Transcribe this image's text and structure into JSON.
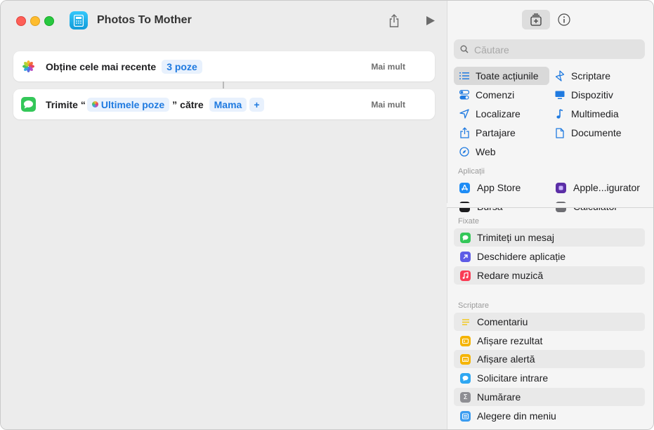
{
  "window": {
    "title": "Photos To Mother"
  },
  "actions": [
    {
      "verb": "Obține cele mai recente",
      "count": "3 poze",
      "more": "Mai mult"
    },
    {
      "verb": "Trimite",
      "quote_open": "“",
      "variable": "Ultimele poze",
      "quote_close": "”",
      "to": "către",
      "recipient": "Mama",
      "add": "+",
      "more": "Mai mult"
    }
  ],
  "search": {
    "placeholder": "Căutare"
  },
  "categories": [
    {
      "label": "Toate acțiunile",
      "icon": "list-icon"
    },
    {
      "label": "Scriptare",
      "icon": "scripting-icon"
    },
    {
      "label": "Comenzi",
      "icon": "toggles-icon"
    },
    {
      "label": "Dispozitiv",
      "icon": "desktop-icon"
    },
    {
      "label": "Localizare",
      "icon": "location-arrow-icon"
    },
    {
      "label": "Multimedia",
      "icon": "music-note-icon"
    },
    {
      "label": "Partajare",
      "icon": "share-icon"
    },
    {
      "label": "Documente",
      "icon": "document-icon"
    },
    {
      "label": "Web",
      "icon": "compass-icon"
    }
  ],
  "apps_section": "Aplicații",
  "apps": [
    {
      "label": "App Store",
      "icon": "app-store-icon"
    },
    {
      "label": "Apple...igurator",
      "icon": "apple-configurator-icon"
    },
    {
      "label": "Bursa",
      "icon": "stocks-icon"
    },
    {
      "label": "Calculator",
      "icon": "calculator-icon"
    }
  ],
  "pinned_section": "Fixate",
  "pinned": [
    {
      "label": "Trimiteți un mesaj",
      "icon": "messages-icon",
      "color": "#34c759"
    },
    {
      "label": "Deschidere aplicație",
      "icon": "open-app-icon",
      "color": "#5e5ce6"
    },
    {
      "label": "Redare muzică",
      "icon": "music-icon",
      "color": "#fa3c55"
    }
  ],
  "scripting_section": "Scriptare",
  "scripting": [
    {
      "label": "Comentariu",
      "icon": "comment-lines-icon",
      "color": "#f5c400"
    },
    {
      "label": "Afișare rezultat",
      "icon": "show-result-icon",
      "color": "#f5b400"
    },
    {
      "label": "Afișare alertă",
      "icon": "alert-icon",
      "color": "#f5b400"
    },
    {
      "label": "Solicitare intrare",
      "icon": "ask-input-icon",
      "color": "#2ea7f2"
    },
    {
      "label": "Numărare",
      "icon": "sigma-icon",
      "color": "#8e8e93"
    },
    {
      "label": "Alegere din meniu",
      "icon": "menu-icon",
      "color": "#3b9cf0"
    }
  ],
  "colors": {
    "accent": "#1f7ae0",
    "pill_bg": "#e8f1fd"
  }
}
